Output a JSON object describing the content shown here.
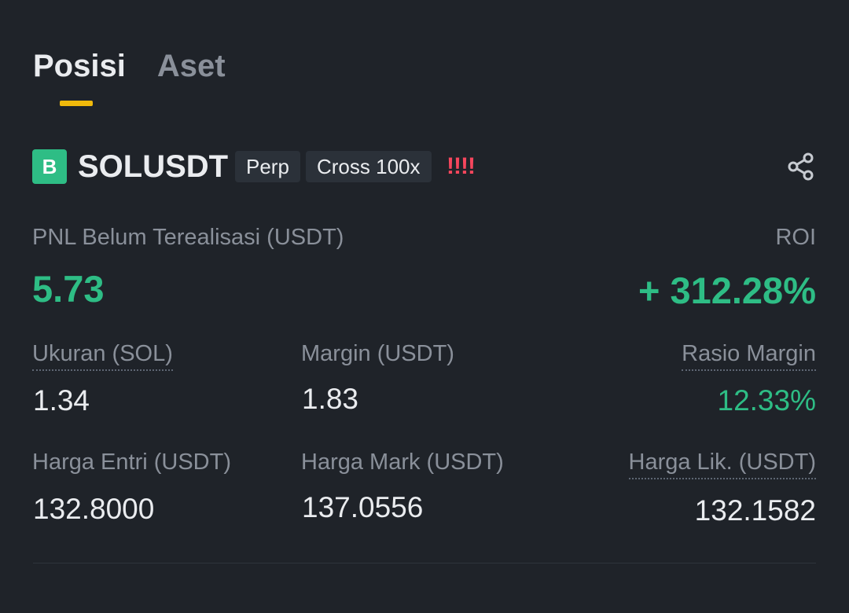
{
  "colors": {
    "accent_yellow": "#f0b90b",
    "positive_green": "#2ebd85",
    "badge_green": "#2ebd85",
    "warning_red": "#f6465d",
    "text_primary": "#eaecef",
    "text_secondary": "#8a909a"
  },
  "tabs": [
    {
      "label": "Posisi",
      "active": true
    },
    {
      "label": "Aset",
      "active": false
    }
  ],
  "position": {
    "exchange_badge": "B",
    "symbol": "SOLUSDT",
    "type_tag": "Perp",
    "margin_tag": "Cross 100x",
    "warning": "!!!!",
    "share_icon": "share-icon",
    "pnl": {
      "label": "PNL Belum Terealisasi (USDT)",
      "value": "5.73"
    },
    "roi": {
      "label": "ROI",
      "value": "+ 312.28%"
    },
    "size": {
      "label": "Ukuran (SOL)",
      "value": "1.34"
    },
    "margin": {
      "label": "Margin (USDT)",
      "value": "1.83"
    },
    "margin_ratio": {
      "label": "Rasio Margin",
      "value": "12.33%"
    },
    "entry_price": {
      "label": "Harga Entri (USDT)",
      "value": "132.8000"
    },
    "mark_price": {
      "label": "Harga Mark (USDT)",
      "value": "137.0556"
    },
    "liq_price": {
      "label": "Harga Lik. (USDT)",
      "value": "132.1582"
    }
  }
}
